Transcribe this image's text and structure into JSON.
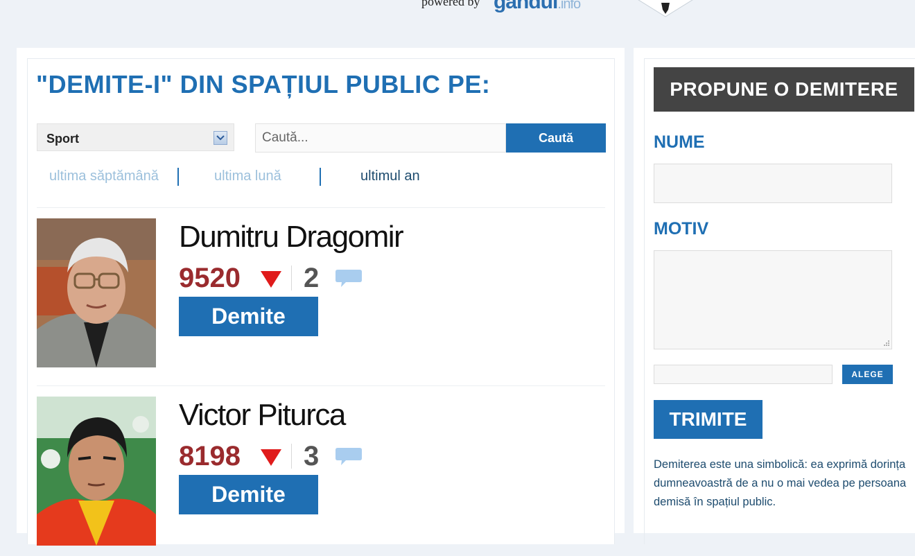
{
  "header": {
    "powered_by": "powered by",
    "brand": "gândul",
    "brand_tld": ".info"
  },
  "colors": {
    "accent": "#1f6fb3",
    "score": "#9a2b2e",
    "dark_header": "#444444"
  },
  "main": {
    "heading": "\"DEMITE-I\" DIN SPAȚIUL PUBLIC PE:",
    "category": {
      "selected": "Sport"
    },
    "search": {
      "placeholder": "Caută...",
      "button": "Caută"
    },
    "periods": [
      "ultima săptămână",
      "ultima lună",
      "ultimul an"
    ],
    "active_period": "ultimul an",
    "people": [
      {
        "name": "Dumitru Dragomir",
        "score": "9520",
        "comments": "2",
        "button": "Demite"
      },
      {
        "name": "Victor Piturca",
        "score": "8198",
        "comments": "3",
        "button": "Demite"
      }
    ]
  },
  "form": {
    "title": "PROPUNE O DEMITERE",
    "nume_label": "NUME",
    "motiv_label": "MOTIV",
    "alege_button": "ALEGE",
    "submit_button": "TRIMITE",
    "note": "Demiterea este una simbolică: ea exprimă dorința dumneavoastră de a nu o mai vedea pe persoana demisă în spațiul public."
  },
  "icons": [
    "chevron-down-icon",
    "thumb-down-arrow-icon",
    "comment-bubble-icon",
    "tie-icon",
    "resize-grip-icon"
  ]
}
